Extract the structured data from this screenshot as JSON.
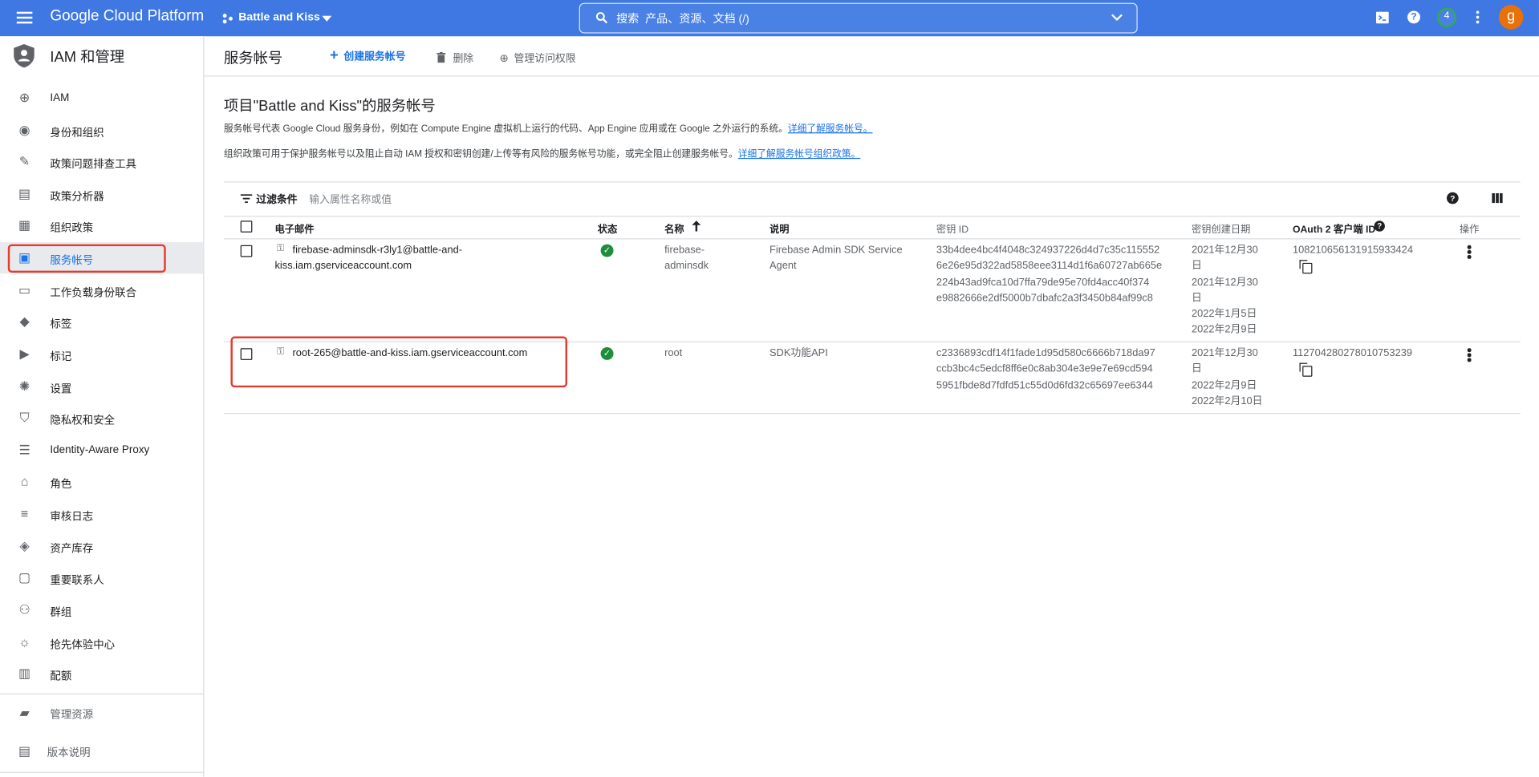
{
  "topbar": {
    "brand": "Google Cloud Platform",
    "project": "Battle and Kiss",
    "search_placeholder": "搜索  产品、资源、文档 (/)",
    "notification_count": "4",
    "avatar_letter": "g"
  },
  "sidebar": {
    "title": "IAM 和管理",
    "items": [
      {
        "label": "IAM",
        "icon": "person-add-icon"
      },
      {
        "label": "身份和组织",
        "icon": "account-circle-icon"
      },
      {
        "label": "政策问题排查工具",
        "icon": "wrench-icon"
      },
      {
        "label": "政策分析器",
        "icon": "policy-search-icon"
      },
      {
        "label": "组织政策",
        "icon": "article-icon"
      },
      {
        "label": "服务帐号",
        "icon": "service-account-icon",
        "active": true
      },
      {
        "label": "工作负载身份联合",
        "icon": "id-card-icon"
      },
      {
        "label": "标签",
        "icon": "tag-icon"
      },
      {
        "label": "标记",
        "icon": "label-icon"
      },
      {
        "label": "设置",
        "icon": "gear-icon"
      },
      {
        "label": "隐私权和安全",
        "icon": "shield-icon"
      },
      {
        "label": "Identity-Aware Proxy",
        "icon": "list-icon"
      },
      {
        "label": "角色",
        "icon": "hat-icon"
      },
      {
        "label": "审核日志",
        "icon": "lines-icon"
      },
      {
        "label": "资产库存",
        "icon": "diamond-icon"
      },
      {
        "label": "重要联系人",
        "icon": "contact-icon"
      },
      {
        "label": "群组",
        "icon": "group-icon"
      },
      {
        "label": "抢先体验中心",
        "icon": "sun-icon"
      },
      {
        "label": "配额",
        "icon": "quota-icon"
      }
    ],
    "manage_resources": "管理资源",
    "release_notes": "版本说明"
  },
  "header": {
    "title": "服务帐号",
    "create_label": "创建服务帐号",
    "delete_label": "删除",
    "manage_access_label": "管理访问权限"
  },
  "main": {
    "heading": "项目\"Battle and Kiss\"的服务帐号",
    "desc1": "服务帐号代表 Google Cloud 服务身份，例如在 Compute Engine 虚拟机上运行的代码、App Engine 应用或在 Google 之外运行的系统。",
    "desc1_link": "详细了解服务帐号。",
    "desc2": "组织政策可用于保护服务帐号以及阻止自动 IAM 授权和密钥创建/上传等有风险的服务帐号功能，或完全阻止创建服务帐号。",
    "desc2_link": "详细了解服务帐号组织政策。"
  },
  "filter": {
    "label": "过滤条件",
    "placeholder": "输入属性名称或值"
  },
  "table": {
    "columns": {
      "email": "电子邮件",
      "status": "状态",
      "name": "名称",
      "description": "说明",
      "key_id": "密钥 ID",
      "key_date": "密钥创建日期",
      "oauth": "OAuth 2 客户端 ID",
      "actions": "操作"
    },
    "rows": [
      {
        "email_1": "firebase-adminsdk-r3ly1@battle-and-",
        "email_2": "kiss.iam.gserviceaccount.com",
        "name_1": "firebase-",
        "name_2": "adminsdk",
        "desc_1": "Firebase Admin SDK Service",
        "desc_2": "Agent",
        "key_1": "33b4dee4bc4f4048c324937226d4d7c35c115552",
        "key_2": "6e26e95d322ad5858eee3114d1f6a60727ab665e",
        "key_3": "224b43ad9fca10d7ffa79de95e70fd4acc40f374",
        "key_4": "e9882666e2df5000b7dbafc2a3f3450b84af99c8",
        "date_1": "2021年12月30",
        "date_2": "日",
        "date_3": "2021年12月30",
        "date_4": "日",
        "date_5": "2022年1月5日",
        "date_6": "2022年2月9日",
        "oauth_id": "108210656131915933424"
      },
      {
        "email_1": "root-265@battle-and-kiss.iam.gserviceaccount.com",
        "name_1": "root",
        "desc_1": "SDK功能API",
        "key_1": "c2336893cdf14f1fade1d95d580c6666b718da97",
        "key_2": "ccb3bc4c5edcf8ff6e0c8ab304e3e9e7e69cd594",
        "key_3": "5951fbde8d7fdfd51c55d0d6fd32c65697ee6344",
        "date_1": "2021年12月30",
        "date_2": "日",
        "date_3": "2022年2月9日",
        "date_4": "2022年2月10日",
        "oauth_id": "112704280278010753239"
      }
    ]
  },
  "colors": {
    "topbar": "#3f78e3",
    "accent": "#1a73e8",
    "highlight_box": "#e53a2f",
    "status_ok": "#1e8e3e",
    "avatar": "#e8710a"
  }
}
